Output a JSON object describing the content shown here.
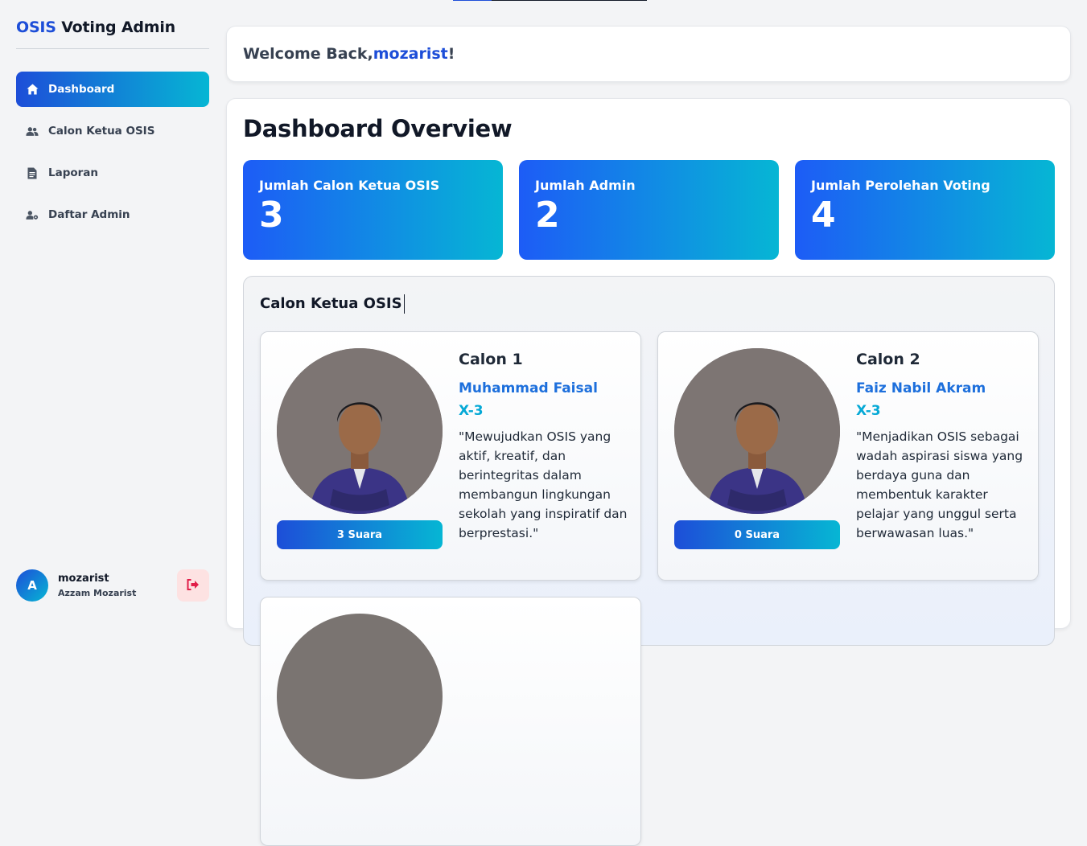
{
  "sidebar": {
    "brand_accent": "OSIS",
    "brand_rest": " Voting Admin",
    "items": [
      {
        "label": "Dashboard",
        "icon": "home-icon",
        "active": true
      },
      {
        "label": "Calon Ketua OSIS",
        "icon": "users-icon",
        "active": false
      },
      {
        "label": "Laporan",
        "icon": "document-icon",
        "active": false
      },
      {
        "label": "Daftar Admin",
        "icon": "user-gear-icon",
        "active": false
      }
    ],
    "user": {
      "initial": "A",
      "username": "mozarist",
      "full_name": "Azzam Mozarist"
    },
    "logout_icon": "logout-icon"
  },
  "welcome": {
    "prefix": "Welcome Back, ",
    "username": "mozarist",
    "suffix": "!"
  },
  "overview": {
    "title": "Dashboard Overview",
    "stats": [
      {
        "label": "Jumlah Calon Ketua OSIS",
        "value": "3"
      },
      {
        "label": "Jumlah Admin",
        "value": "2"
      },
      {
        "label": "Jumlah Perolehan Voting",
        "value": "4"
      }
    ]
  },
  "candidates": {
    "title": "Calon Ketua OSIS",
    "list": [
      {
        "number": "Calon 1",
        "name": "Muhammad Faisal",
        "class": "X-3",
        "vision": "\"Mewujudkan OSIS yang aktif, kreatif, dan berintegritas dalam membangun lingkungan sekolah yang inspiratif dan berprestasi.\"",
        "votes": "3 Suara"
      },
      {
        "number": "Calon 2",
        "name": "Faiz Nabil Akram",
        "class": "X-3",
        "vision": "\"Menjadikan OSIS sebagai wadah aspirasi siswa yang berdaya guna dan membentuk karakter pelajar yang unggul serta berwawasan luas.\"",
        "votes": "0 Suara"
      }
    ]
  },
  "colors": {
    "accent_blue": "#1d4ed8",
    "accent_cyan": "#06b6d4",
    "logout_bg": "#fde2e2",
    "logout_icon": "#e11d48"
  }
}
